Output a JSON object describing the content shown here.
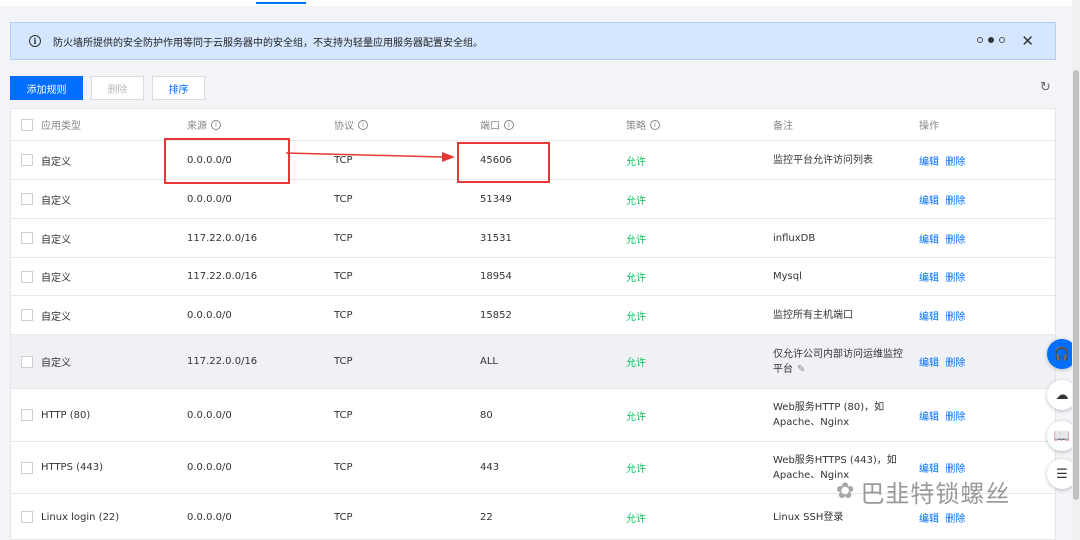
{
  "notice": {
    "text": "防火墙所提供的安全防护作用等同于云服务器中的安全组，不支持为轻量应用服务器配置安全组。",
    "info_icon": "info-icon",
    "close_icon": "close-icon"
  },
  "toolbar": {
    "add_label": "添加规则",
    "delete_label": "删除",
    "sort_label": "排序",
    "refresh_icon": "refresh-icon"
  },
  "table": {
    "headers": [
      "应用类型",
      "来源",
      "协议",
      "端口",
      "策略",
      "备注",
      "操作"
    ],
    "edit_label": "编辑",
    "delete_label": "删除",
    "rows": [
      {
        "type": "自定义",
        "source": "0.0.0.0/0",
        "protocol": "TCP",
        "port": "45606",
        "policy": "允许",
        "note1": "监控平台允许访问列表",
        "note2": ""
      },
      {
        "type": "自定义",
        "source": "0.0.0.0/0",
        "protocol": "TCP",
        "port": "51349",
        "policy": "允许",
        "note1": "",
        "note2": ""
      },
      {
        "type": "自定义",
        "source": "117.22.0.0/16",
        "protocol": "TCP",
        "port": "31531",
        "policy": "允许",
        "note1": "influxDB",
        "note2": ""
      },
      {
        "type": "自定义",
        "source": "117.22.0.0/16",
        "protocol": "TCP",
        "port": "18954",
        "policy": "允许",
        "note1": "Mysql",
        "note2": ""
      },
      {
        "type": "自定义",
        "source": "0.0.0.0/0",
        "protocol": "TCP",
        "port": "15852",
        "policy": "允许",
        "note1": "监控所有主机端口",
        "note2": ""
      },
      {
        "type": "自定义",
        "source": "117.22.0.0/16",
        "protocol": "TCP",
        "port": "ALL",
        "policy": "允许",
        "note1": "仅允许公司内部访问运维监控",
        "note2": "平台"
      },
      {
        "type": "HTTP (80)",
        "source": "0.0.0.0/0",
        "protocol": "TCP",
        "port": "80",
        "policy": "允许",
        "note1": "Web服务HTTP (80)，如",
        "note2": "Apache、Nginx"
      },
      {
        "type": "HTTPS (443)",
        "source": "0.0.0.0/0",
        "protocol": "TCP",
        "port": "443",
        "policy": "允许",
        "note1": "Web服务HTTPS (443)，如",
        "note2": "Apache、Nginx"
      },
      {
        "type": "Linux login (22)",
        "source": "0.0.0.0/0",
        "protocol": "TCP",
        "port": "22",
        "policy": "允许",
        "note1": "Linux SSH登录",
        "note2": ""
      }
    ]
  },
  "watermark": {
    "text": "巴韭特锁螺丝"
  },
  "colors": {
    "primary": "#006eff",
    "allow": "#0abf5b",
    "annotation": "#e53935",
    "notice_bg": "#d5e7fe"
  }
}
